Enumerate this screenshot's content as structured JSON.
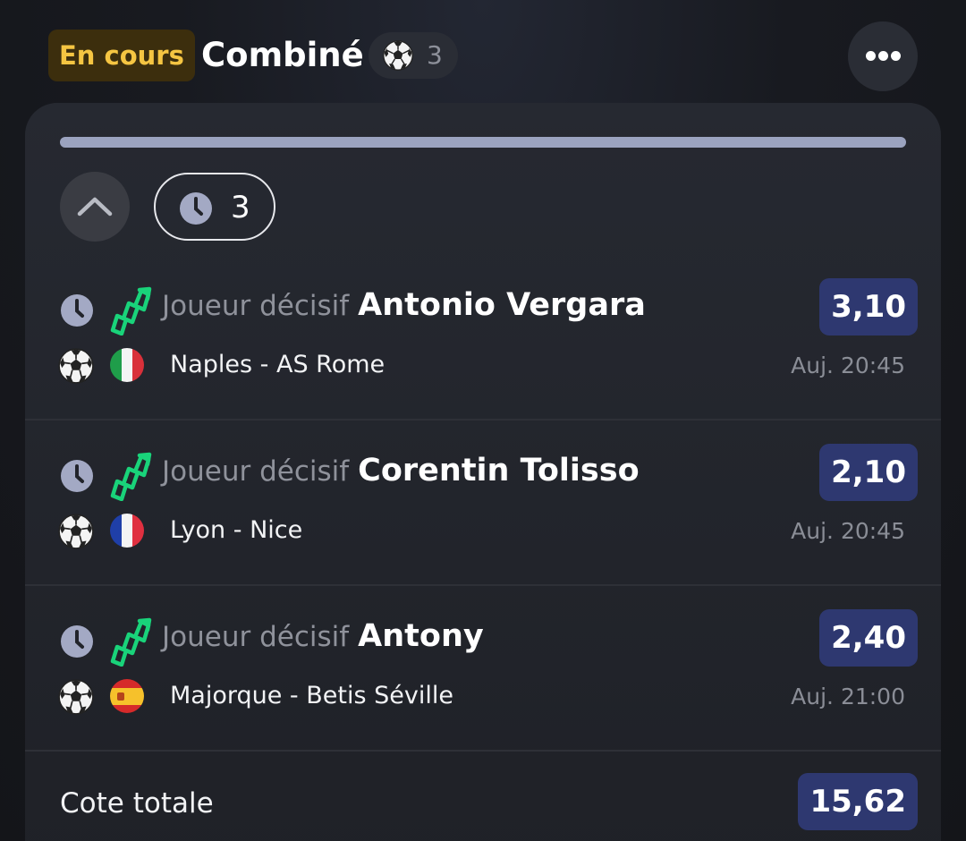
{
  "header": {
    "status": "En cours",
    "title": "Combiné",
    "selections_count": "3",
    "sport_icon": "soccer-ball-icon",
    "more_icon": "more-horizontal-icon"
  },
  "progress": {
    "fraction": 1.0
  },
  "filters": {
    "collapse_icon": "chevron-up-icon",
    "pending_icon": "clock-icon",
    "pending_count": "3"
  },
  "legs": [
    {
      "market": "Joueur décisif",
      "player": "Antonio Vergara",
      "odds": "3,10",
      "match": "Naples - AS Rome",
      "time": "Auj. 20:45",
      "flag": "italy-flag-icon"
    },
    {
      "market": "Joueur décisif",
      "player": "Corentin Tolisso",
      "odds": "2,10",
      "match": "Lyon - Nice",
      "time": "Auj. 20:45",
      "flag": "france-flag-icon"
    },
    {
      "market": "Joueur décisif",
      "player": "Antony",
      "odds": "2,40",
      "match": "Majorque - Betis Séville",
      "time": "Auj. 21:00",
      "flag": "spain-flag-icon"
    }
  ],
  "total": {
    "label": "Cote totale",
    "odds": "15,62"
  },
  "colors": {
    "status_bg": "#3c2e0d",
    "status_text": "#f5c542",
    "odds_bg": "#2e3870",
    "boost_green": "#19d37a",
    "progress": "#9ba3bf"
  }
}
